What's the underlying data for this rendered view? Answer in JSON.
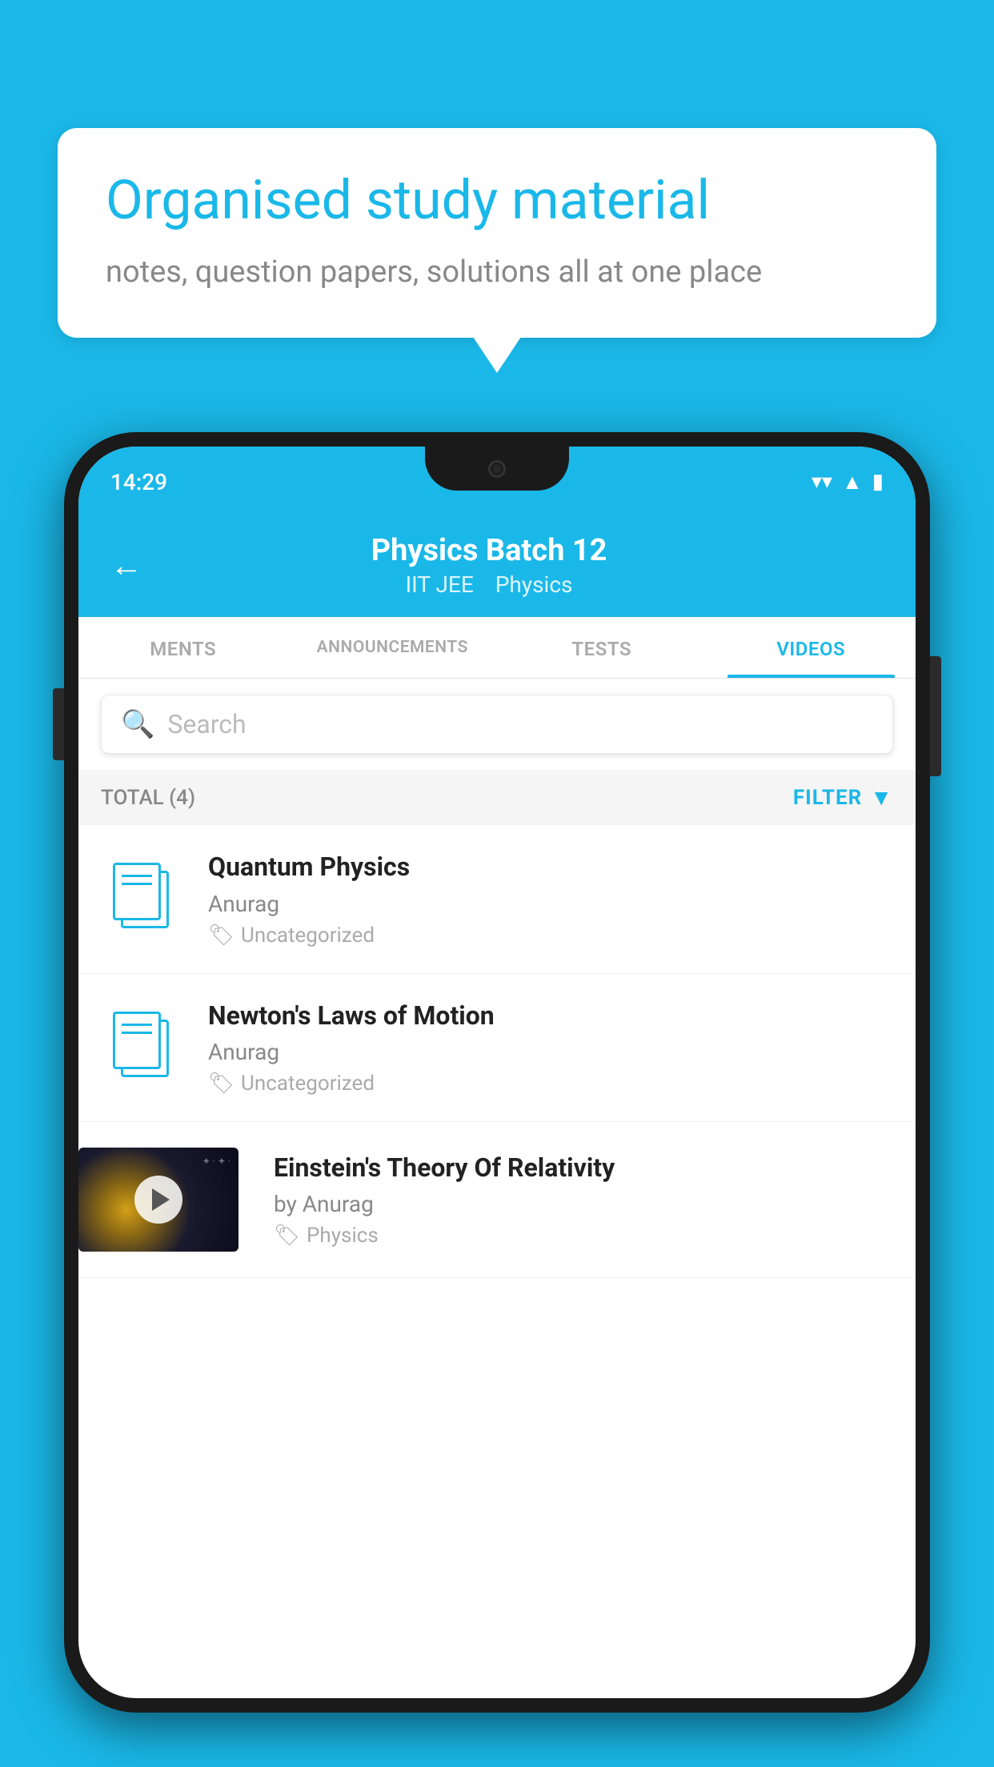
{
  "background_color": "#1ab8e8",
  "speech_bubble": {
    "title": "Organised study material",
    "subtitle": "notes, question papers, solutions all at one place"
  },
  "phone": {
    "status_bar": {
      "time": "14:29",
      "icons": [
        "wifi",
        "signal",
        "battery"
      ]
    },
    "app_header": {
      "title": "Physics Batch 12",
      "subtitle_parts": [
        "IIT JEE",
        "Physics"
      ],
      "back_label": "←"
    },
    "tabs": [
      {
        "label": "MENTS",
        "active": false
      },
      {
        "label": "ANNOUNCEMENTS",
        "active": false
      },
      {
        "label": "TESTS",
        "active": false
      },
      {
        "label": "VIDEOS",
        "active": true
      }
    ],
    "search": {
      "placeholder": "Search"
    },
    "filter_bar": {
      "total_label": "TOTAL (4)",
      "filter_label": "FILTER"
    },
    "videos": [
      {
        "title": "Quantum Physics",
        "author": "Anurag",
        "tag": "Uncategorized",
        "has_thumb": false
      },
      {
        "title": "Newton's Laws of Motion",
        "author": "Anurag",
        "tag": "Uncategorized",
        "has_thumb": false
      },
      {
        "title": "Einstein's Theory Of Relativity",
        "author": "by Anurag",
        "tag": "Physics",
        "has_thumb": true
      }
    ]
  }
}
